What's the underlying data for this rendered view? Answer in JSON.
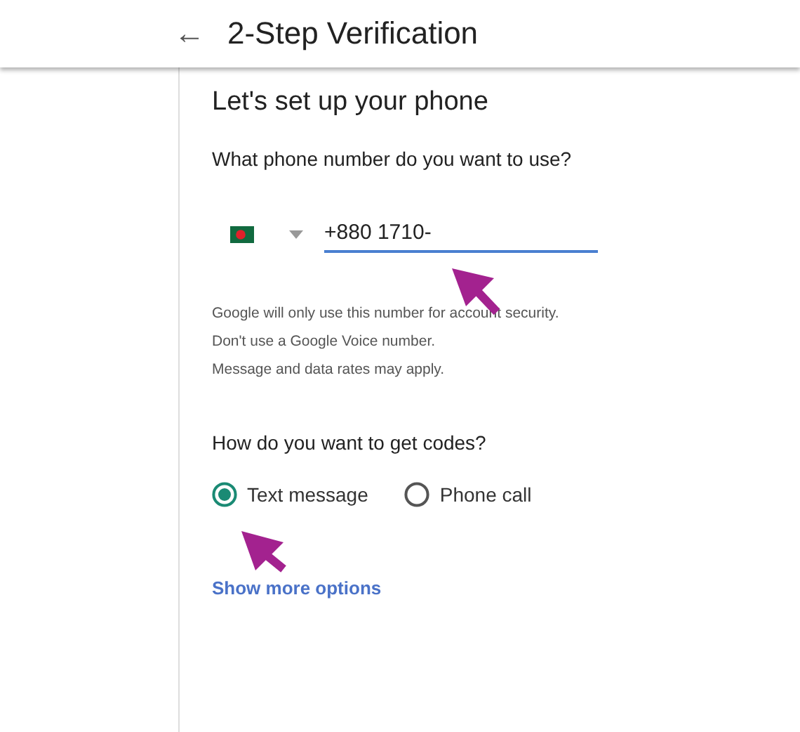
{
  "header": {
    "back": "←",
    "title": "2-Step Verification"
  },
  "heading": "Let's set up your phone",
  "question": "What phone number do you want to use?",
  "phone": {
    "value": "+880 1710-",
    "focused": true
  },
  "help_lines": [
    "Google will only use this number for account security.",
    "Don't use a Google Voice number.",
    "Message and data rates may apply."
  ],
  "codes_question": "How do you want to get codes?",
  "options": [
    {
      "label": "Text message",
      "selected": true
    },
    {
      "label": "Phone call",
      "selected": false
    }
  ],
  "link": "Show more options"
}
